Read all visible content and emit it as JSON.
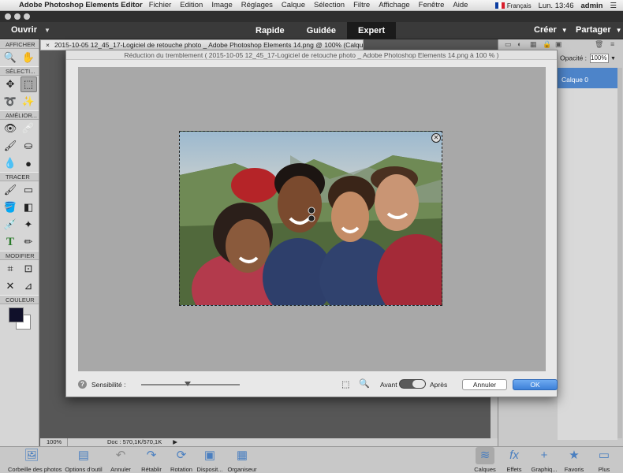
{
  "menubar": {
    "app_name": "Adobe Photoshop Elements Editor",
    "items": [
      "Fichier",
      "Edition",
      "Image",
      "Réglages",
      "Calque",
      "Sélection",
      "Filtre",
      "Affichage",
      "Fenêtre",
      "Aide"
    ],
    "language": "Français",
    "clock": "Lun. 13:46",
    "user": "admin"
  },
  "appbar": {
    "open_label": "Ouvrir",
    "modes": [
      "Rapide",
      "Guidée",
      "Expert"
    ],
    "active_mode": "Expert",
    "create_label": "Créer",
    "share_label": "Partager"
  },
  "toolbox": {
    "sections": {
      "view": "AFFICHER",
      "select": "SÉLECTI...",
      "enhance": "AMÉLIOR...",
      "draw": "TRACER",
      "modify": "MODIFIER",
      "color": "COULEUR"
    },
    "foreground_color": "#10102a",
    "background_color": "#ffffff"
  },
  "document": {
    "tab_title": "2015-10-05 12_45_17-Logiciel de retouche photo _ Adobe Photoshop Elements 14.png @ 100% (Calque 0, RVB/8) *",
    "zoom": "100%",
    "doc_info": "Doc : 570,1K/570,1K"
  },
  "panel": {
    "opacity_label": "Opacité :",
    "opacity_value": "100%",
    "layer_name": "Calque 0"
  },
  "dialog": {
    "title": "Réduction du tremblement ( 2015-10-05 12_45_17-Logiciel de retouche photo _ Adobe Photoshop Elements 14.png à 100 % )",
    "sensitivity_label": "Sensibilité :",
    "sensitivity_level": 0.47,
    "before_label": "Avant",
    "after_label": "Après",
    "cancel_label": "Annuler",
    "ok_label": "OK"
  },
  "bottombar": {
    "items": [
      {
        "label": "Corbeille des photos"
      },
      {
        "label": "Options d'outil"
      },
      {
        "label": "Annuler"
      },
      {
        "label": "Rétablir"
      },
      {
        "label": "Rotation"
      },
      {
        "label": "Disposit..."
      },
      {
        "label": "Organiseur"
      },
      {
        "label": "Calques"
      },
      {
        "label": "Effets"
      },
      {
        "label": "Graphiq..."
      },
      {
        "label": "Favoris"
      },
      {
        "label": "Plus"
      }
    ]
  }
}
